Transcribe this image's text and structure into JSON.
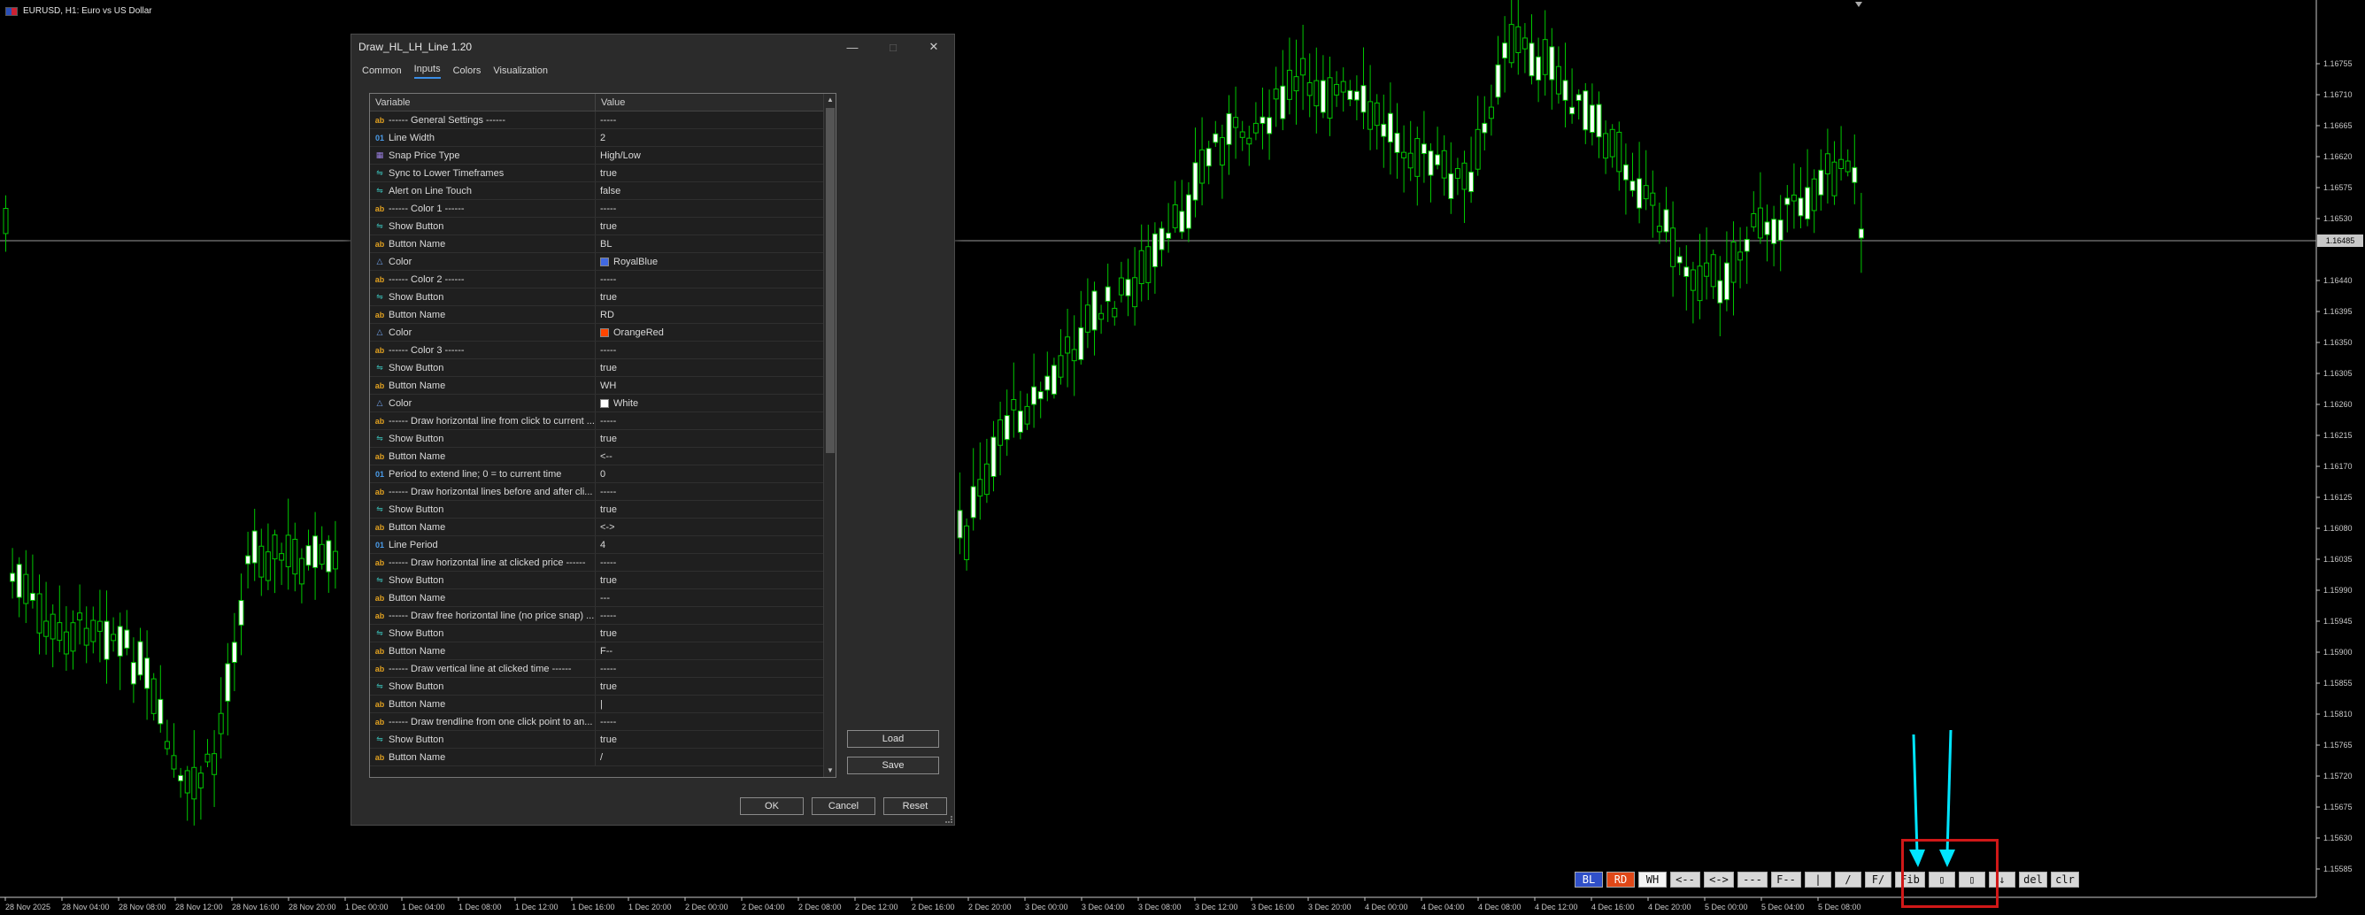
{
  "chart": {
    "symbol_label": "EURUSD, H1: Euro vs US Dollar",
    "current_price": "1.16485",
    "price_ticks": [
      "1.16755",
      "1.16710",
      "1.16665",
      "1.16620",
      "1.16575",
      "1.16530",
      "1.16440",
      "1.16395",
      "1.16350",
      "1.16305",
      "1.16260",
      "1.16215",
      "1.16170",
      "1.16125",
      "1.16080",
      "1.16035",
      "1.15990",
      "1.15945",
      "1.15900",
      "1.15855",
      "1.15810",
      "1.15765",
      "1.15720",
      "1.15675",
      "1.15630",
      "1.15585"
    ],
    "time_ticks": [
      "28 Nov 2025",
      "28 Nov 04:00",
      "28 Nov 08:00",
      "28 Nov 12:00",
      "28 Nov 16:00",
      "28 Nov 20:00",
      "1 Dec 00:00",
      "1 Dec 04:00",
      "1 Dec 08:00",
      "1 Dec 12:00",
      "1 Dec 16:00",
      "1 Dec 20:00",
      "2 Dec 00:00",
      "2 Dec 04:00",
      "2 Dec 08:00",
      "2 Dec 12:00",
      "2 Dec 16:00",
      "2 Dec 20:00",
      "3 Dec 00:00",
      "3 Dec 04:00",
      "3 Dec 08:00",
      "3 Dec 12:00",
      "3 Dec 16:00",
      "3 Dec 20:00",
      "4 Dec 00:00",
      "4 Dec 04:00",
      "4 Dec 08:00",
      "4 Dec 12:00",
      "4 Dec 16:00",
      "4 Dec 20:00",
      "5 Dec 00:00",
      "5 Dec 04:00",
      "5 Dec 08:00"
    ]
  },
  "dialog": {
    "title": "Draw_HL_LH_Line 1.20",
    "tabs": [
      "Common",
      "Inputs",
      "Colors",
      "Visualization"
    ],
    "columns": {
      "variable": "Variable",
      "value": "Value"
    },
    "rows": [
      {
        "icon": "ab",
        "name": "------ General Settings ------",
        "value": "-----"
      },
      {
        "icon": "01",
        "name": "Line Width",
        "value": "2"
      },
      {
        "icon": "enum",
        "name": "Snap Price Type",
        "value": "High/Low"
      },
      {
        "icon": "bool",
        "name": "Sync to Lower Timeframes",
        "value": "true"
      },
      {
        "icon": "bool",
        "name": "Alert on Line Touch",
        "value": "false"
      },
      {
        "icon": "ab",
        "name": "------ Color 1 ------",
        "value": "-----"
      },
      {
        "icon": "bool",
        "name": "Show Button",
        "value": "true"
      },
      {
        "icon": "ab",
        "name": "Button Name",
        "value": "BL"
      },
      {
        "icon": "color",
        "name": "Color",
        "value": "RoyalBlue",
        "swatch": "#4169e1"
      },
      {
        "icon": "ab",
        "name": "------ Color 2 ------",
        "value": "-----"
      },
      {
        "icon": "bool",
        "name": "Show Button",
        "value": "true"
      },
      {
        "icon": "ab",
        "name": "Button Name",
        "value": "RD"
      },
      {
        "icon": "color",
        "name": "Color",
        "value": "OrangeRed",
        "swatch": "#ff4500"
      },
      {
        "icon": "ab",
        "name": "------ Color 3 ------",
        "value": "-----"
      },
      {
        "icon": "bool",
        "name": "Show Button",
        "value": "true"
      },
      {
        "icon": "ab",
        "name": "Button Name",
        "value": "WH"
      },
      {
        "icon": "color",
        "name": "Color",
        "value": "White",
        "swatch": "#ffffff"
      },
      {
        "icon": "ab",
        "name": "------ Draw horizontal line from click to current ...",
        "value": "-----"
      },
      {
        "icon": "bool",
        "name": "Show Button",
        "value": "true"
      },
      {
        "icon": "ab",
        "name": "Button Name",
        "value": "<--"
      },
      {
        "icon": "01",
        "name": "Period to extend line; 0 = to current time",
        "value": "0"
      },
      {
        "icon": "ab",
        "name": "------ Draw horizontal lines before and after cli...",
        "value": "-----"
      },
      {
        "icon": "bool",
        "name": "Show Button",
        "value": "true"
      },
      {
        "icon": "ab",
        "name": "Button Name",
        "value": "<->"
      },
      {
        "icon": "01",
        "name": "Line Period",
        "value": "4"
      },
      {
        "icon": "ab",
        "name": "------ Draw horizontal line at clicked price ------",
        "value": "-----"
      },
      {
        "icon": "bool",
        "name": "Show Button",
        "value": "true"
      },
      {
        "icon": "ab",
        "name": "Button Name",
        "value": "---"
      },
      {
        "icon": "ab",
        "name": "------ Draw free horizontal line (no price snap) ...",
        "value": "-----"
      },
      {
        "icon": "bool",
        "name": "Show Button",
        "value": "true"
      },
      {
        "icon": "ab",
        "name": "Button Name",
        "value": "F--"
      },
      {
        "icon": "ab",
        "name": "------ Draw vertical line at clicked time ------",
        "value": "-----"
      },
      {
        "icon": "bool",
        "name": "Show Button",
        "value": "true"
      },
      {
        "icon": "ab",
        "name": "Button Name",
        "value": "|"
      },
      {
        "icon": "ab",
        "name": "------ Draw trendline from one click point to an...",
        "value": "-----"
      },
      {
        "icon": "bool",
        "name": "Show Button",
        "value": "true"
      },
      {
        "icon": "ab",
        "name": "Button Name",
        "value": "/"
      }
    ],
    "buttons": {
      "load": "Load",
      "save": "Save",
      "ok": "OK",
      "cancel": "Cancel",
      "reset": "Reset"
    }
  },
  "toolbar": {
    "buttons": [
      {
        "label": "BL",
        "style": "blue"
      },
      {
        "label": "RD",
        "style": "red"
      },
      {
        "label": "WH",
        "style": "white"
      },
      {
        "label": "<--",
        "style": "gray"
      },
      {
        "label": "<->",
        "style": "gray"
      },
      {
        "label": "---",
        "style": "gray"
      },
      {
        "label": "F--",
        "style": "gray"
      },
      {
        "label": "|",
        "style": "gray"
      },
      {
        "label": "/",
        "style": "gray"
      },
      {
        "label": "F/",
        "style": "gray"
      },
      {
        "label": "Fib",
        "style": "gray"
      },
      {
        "label": "▯",
        "style": "gray"
      },
      {
        "label": "▯",
        "style": "gray"
      },
      {
        "label": "↓",
        "style": "gray"
      },
      {
        "label": "del",
        "style": "gray"
      },
      {
        "label": "clr",
        "style": "gray"
      }
    ]
  },
  "colors": {
    "bull": "#ffffff",
    "wick": "#00c800",
    "annotation": "#00e5ff",
    "highlight": "#d01818"
  }
}
